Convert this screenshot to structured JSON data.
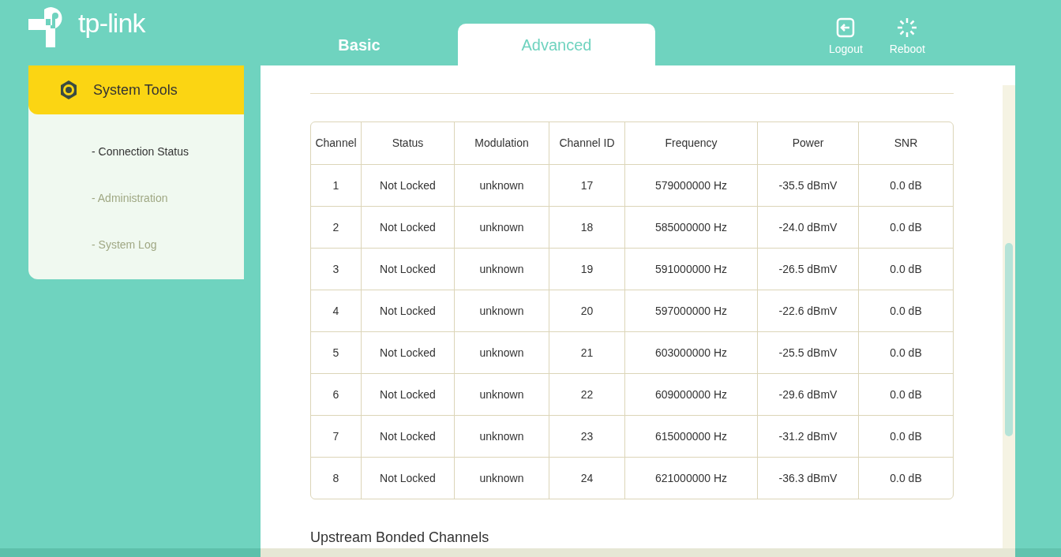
{
  "logo": {
    "text": "tp-link"
  },
  "tabs": [
    {
      "label": "Basic",
      "selected": false
    },
    {
      "label": "Advanced",
      "selected": true
    }
  ],
  "header_actions": [
    {
      "kind": "logout",
      "label": "Logout"
    },
    {
      "kind": "reboot",
      "label": "Reboot"
    }
  ],
  "sidebar": {
    "title": "System Tools",
    "items": [
      {
        "label": "- Connection Status",
        "selected": true
      },
      {
        "label": "- Administration",
        "selected": false
      },
      {
        "label": "- System Log",
        "selected": false
      }
    ]
  },
  "table": {
    "columns": [
      "Channel",
      "Status",
      "Modulation",
      "Channel ID",
      "Frequency",
      "Power",
      "SNR"
    ],
    "rows": [
      [
        "1",
        "Not Locked",
        "unknown",
        "17",
        "579000000 Hz",
        "-35.5 dBmV",
        "0.0 dB"
      ],
      [
        "2",
        "Not Locked",
        "unknown",
        "18",
        "585000000 Hz",
        "-24.0 dBmV",
        "0.0 dB"
      ],
      [
        "3",
        "Not Locked",
        "unknown",
        "19",
        "591000000 Hz",
        "-26.5 dBmV",
        "0.0 dB"
      ],
      [
        "4",
        "Not Locked",
        "unknown",
        "20",
        "597000000 Hz",
        "-22.6 dBmV",
        "0.0 dB"
      ],
      [
        "5",
        "Not Locked",
        "unknown",
        "21",
        "603000000 Hz",
        "-25.5 dBmV",
        "0.0 dB"
      ],
      [
        "6",
        "Not Locked",
        "unknown",
        "22",
        "609000000 Hz",
        "-29.6 dBmV",
        "0.0 dB"
      ],
      [
        "7",
        "Not Locked",
        "unknown",
        "23",
        "615000000 Hz",
        "-31.2 dBmV",
        "0.0 dB"
      ],
      [
        "8",
        "Not Locked",
        "unknown",
        "24",
        "621000000 Hz",
        "-36.3 dBmV",
        "0.0 dB"
      ]
    ]
  },
  "section_heading": "Upstream Bonded Channels"
}
